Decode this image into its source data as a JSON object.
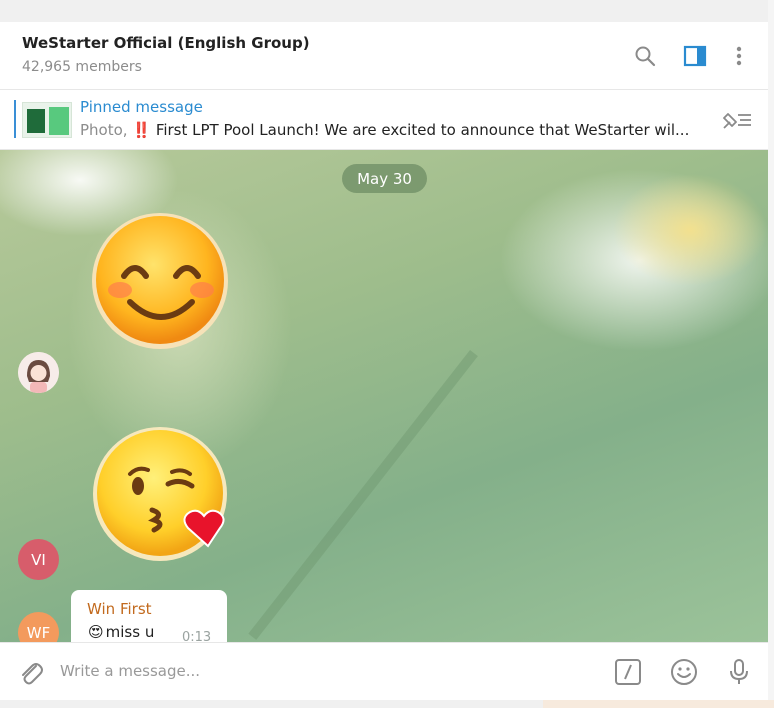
{
  "header": {
    "title": "WeStarter Official (English Group)",
    "members": "42,965 members",
    "icons": [
      "search-icon",
      "side-panel-icon",
      "more-vertical-icon"
    ]
  },
  "pinned": {
    "title": "Pinned message",
    "photo_label": "Photo,",
    "emoji": "‼️",
    "text": "First LPT Pool Launch!  We are excited to announce that WeStarter wil..."
  },
  "chat": {
    "date": "May 30",
    "avatars": {
      "vi": "VI",
      "wf": "WF"
    },
    "stickers": [
      "smiling-face-sticker",
      "kissing-face-heart-sticker"
    ],
    "message": {
      "sender": "Win First",
      "emoji": "😍",
      "text": "miss u",
      "time": "0:13"
    }
  },
  "composer": {
    "placeholder": "Write a message..."
  },
  "colors": {
    "accent": "#2a8bd0",
    "sender": "#c26a1e",
    "avatar_vi": "#d75d6b",
    "avatar_wf": "#f39a5d",
    "date_pill": "#6e8c64"
  }
}
